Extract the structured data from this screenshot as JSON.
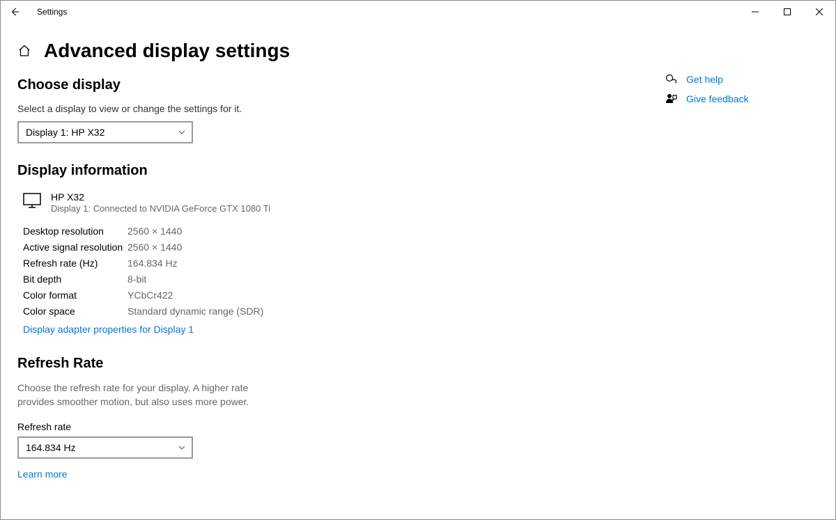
{
  "titlebar": {
    "title": "Settings"
  },
  "page": {
    "title": "Advanced display settings"
  },
  "choose_display": {
    "title": "Choose display",
    "desc": "Select a display to view or change the settings for it.",
    "selected": "Display 1: HP X32"
  },
  "display_info": {
    "title": "Display information",
    "name": "HP X32",
    "sub": "Display 1: Connected to NVIDIA GeForce GTX 1080 Ti",
    "rows": [
      {
        "label": "Desktop resolution",
        "value": "2560 × 1440"
      },
      {
        "label": "Active signal resolution",
        "value": "2560 × 1440"
      },
      {
        "label": "Refresh rate (Hz)",
        "value": "164.834 Hz"
      },
      {
        "label": "Bit depth",
        "value": "8-bit"
      },
      {
        "label": "Color format",
        "value": "YCbCr422"
      },
      {
        "label": "Color space",
        "value": "Standard dynamic range (SDR)"
      }
    ],
    "adapter_link": "Display adapter properties for Display 1"
  },
  "refresh_rate": {
    "title": "Refresh Rate",
    "desc": "Choose the refresh rate for your display. A higher rate provides smoother motion, but also uses more power.",
    "field_label": "Refresh rate",
    "selected": "164.834 Hz",
    "learn_more": "Learn more"
  },
  "right": {
    "get_help": "Get help",
    "give_feedback": "Give feedback"
  }
}
